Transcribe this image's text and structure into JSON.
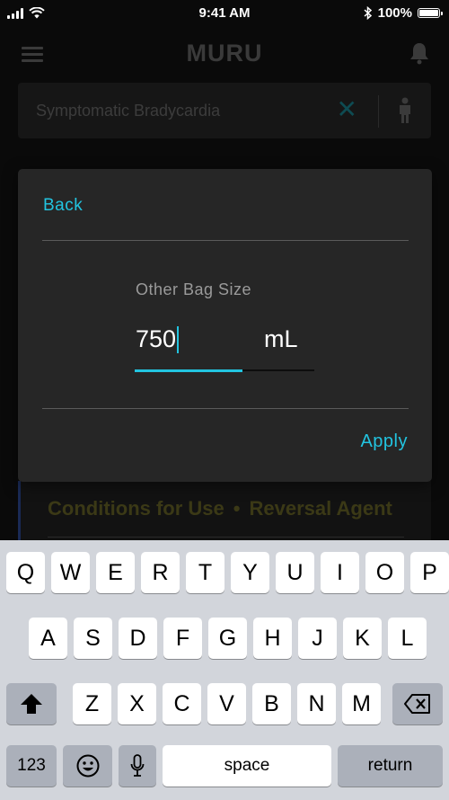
{
  "status_bar": {
    "time": "9:41 AM",
    "battery": "100%"
  },
  "header": {
    "logo": "MURU"
  },
  "search": {
    "value": "Symptomatic Bradycardia"
  },
  "background": {
    "chip1": "Conditions for Use",
    "separator": "•",
    "chip2": "Reversal Agent"
  },
  "dialog": {
    "back_label": "Back",
    "field_label": "Other Bag Size",
    "field_value": "750",
    "unit": "mL",
    "apply_label": "Apply"
  },
  "keyboard": {
    "row1": [
      "Q",
      "W",
      "E",
      "R",
      "T",
      "Y",
      "U",
      "I",
      "O",
      "P"
    ],
    "row2": [
      "A",
      "S",
      "D",
      "F",
      "G",
      "H",
      "J",
      "K",
      "L"
    ],
    "row3": [
      "Z",
      "X",
      "C",
      "V",
      "B",
      "N",
      "M"
    ],
    "numbers_label": "123",
    "space_label": "space",
    "return_label": "return"
  },
  "icons": [
    "signal-icon",
    "wifi-icon",
    "bluetooth-icon",
    "battery-icon",
    "hamburger-icon",
    "bell-icon",
    "clear-icon",
    "person-icon",
    "shift-icon",
    "backspace-icon",
    "emoji-icon",
    "mic-icon"
  ],
  "colors": {
    "accent": "#22c4e0",
    "dialog": "#262626",
    "background": "#0a0a0a"
  }
}
